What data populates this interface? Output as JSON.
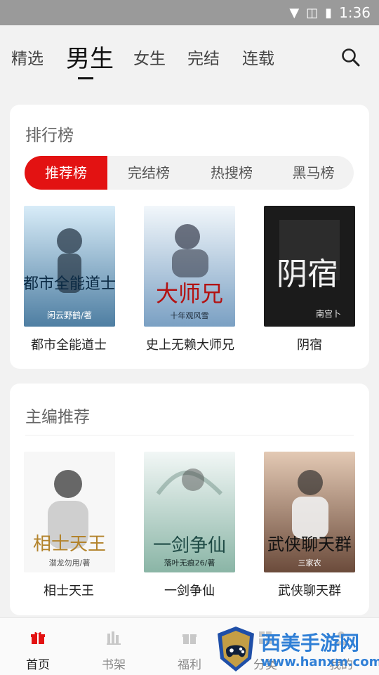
{
  "status": {
    "time": "1:36"
  },
  "top_tabs": [
    "精选",
    "男生",
    "女生",
    "完结",
    "连载"
  ],
  "active_tab_index": 1,
  "ranking": {
    "title": "排行榜",
    "tabs": [
      "推荐榜",
      "完结榜",
      "热搜榜",
      "黑马榜"
    ],
    "active_index": 0,
    "books": [
      {
        "title": "都市全能道士",
        "cover_text": "都市全能道士",
        "cover_author": "闲云野鹤/著",
        "cover_colors": [
          "#cfe3f1",
          "#5b8bb1"
        ]
      },
      {
        "title": "史上无赖大师兄",
        "cover_text": "大师兄",
        "cover_author": "十年观风雪",
        "cover_colors": [
          "#eaf1f7",
          "#7aa0c3"
        ]
      },
      {
        "title": "阴宿",
        "cover_text": "阴宿",
        "cover_author": "南宫卜",
        "cover_colors": [
          "#2a2a2a",
          "#0f0f0f"
        ]
      }
    ]
  },
  "editor": {
    "title": "主编推荐",
    "books": [
      {
        "title": "相士天王",
        "cover_text": "相士天王",
        "cover_author": "潜龙勿用/著",
        "cover_colors": [
          "#f6f6f6",
          "#d7d7d7"
        ]
      },
      {
        "title": "一剑争仙",
        "cover_text": "一剑争仙",
        "cover_author": "落叶无痕26/著",
        "cover_colors": [
          "#e6f1ee",
          "#8ab5a6"
        ]
      },
      {
        "title": "武侠聊天群",
        "cover_text": "武侠聊天群",
        "cover_author": "三家农",
        "cover_colors": [
          "#d7b9a0",
          "#6b4b3b"
        ]
      }
    ]
  },
  "bottom_nav": [
    {
      "label": "首页",
      "icon": "gift-icon"
    },
    {
      "label": "书架",
      "icon": "bookshelf-icon"
    },
    {
      "label": "福利",
      "icon": "gift-icon"
    },
    {
      "label": "分类",
      "icon": "grid-icon"
    },
    {
      "label": "我的",
      "icon": "user-icon"
    }
  ],
  "watermark": {
    "title": "西美手游网",
    "url": "www.hanxm.com"
  },
  "colors": {
    "accent": "#e31212",
    "text": "#222222",
    "muted": "#888888"
  }
}
